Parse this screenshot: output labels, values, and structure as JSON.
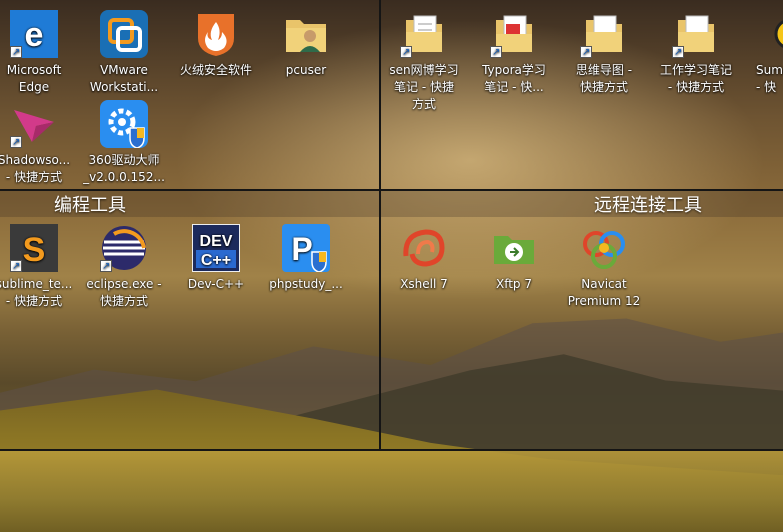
{
  "sections": {
    "coding_tools": "编程工具",
    "remote_tools": "远程连接工具"
  },
  "icons": {
    "edge": "Microsoft\nEdge",
    "vmware": "VMware\nWorkstati...",
    "huorong": "火绒安全软件",
    "pcuser": "pcuser",
    "shadowsocks": "Shadowso...\n- 快捷方式",
    "driver360": "360驱动大师\n_v2.0.0.152...",
    "sen_notes": "sen网博学习\n笔记 - 快捷\n方式",
    "typora_notes": "Typora学习\n笔记 - 快...",
    "mindmap": "思维导图 -\n快捷方式",
    "work_notes": "工作学习笔记\n- 快捷方式",
    "sumatra": "Suma...\n- 快",
    "sublime": "sublime_te...\n- 快捷方式",
    "eclipse": "eclipse.exe -\n快捷方式",
    "devcpp": "Dev-C++",
    "phpstudy": "phpstudy_...",
    "xshell": "Xshell 7",
    "xftp": "Xftp 7",
    "navicat": "Navicat\nPremium 12"
  },
  "icon_glyphs": {
    "devcpp_top": "DEV",
    "devcpp_bottom": "C++",
    "phpstudy": "P",
    "sublime": "S"
  },
  "colors": {
    "edge": "#1f7bd6",
    "vmware": "#1a6fb5",
    "huorong": "#e8712a",
    "folder": "#e9c46a",
    "driver360": "#2a8ef0",
    "sublime": "#3a3a3a",
    "eclipse": "#2c2a6a",
    "devcpp": "#1c2a5c",
    "phpstudy": "#2a8ef0"
  }
}
